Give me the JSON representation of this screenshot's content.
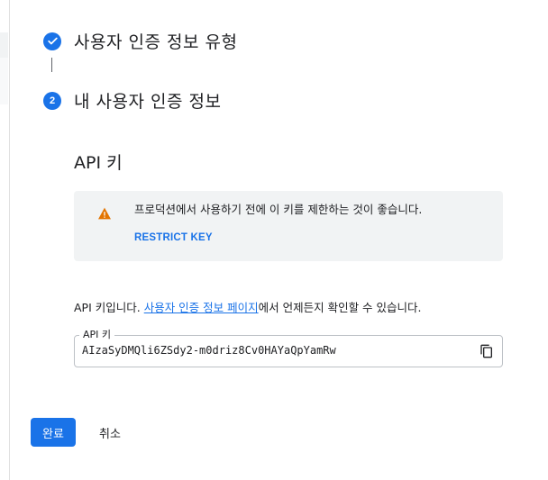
{
  "steps": [
    {
      "number": "",
      "title": "사용자 인증 정보 유형",
      "status": "complete",
      "icon": "check-icon"
    },
    {
      "number": "2",
      "title": "내 사용자 인증 정보",
      "status": "active"
    }
  ],
  "section": {
    "title": "API 키"
  },
  "warning": {
    "icon": "warning-icon",
    "text": "프로덕션에서 사용하기 전에 이 키를 제한하는 것이 좋습니다.",
    "action_label": "RESTRICT KEY"
  },
  "info": {
    "prefix": "API 키입니다. ",
    "link_text": "사용자 인증 정보 페이지",
    "suffix": "에서 언제든지 확인할 수 있습니다."
  },
  "key_field": {
    "label": "API 키",
    "value": "AIzaSyDMQli6ZSdy2-m0driz8Cv0HAYaQpYamRw",
    "copy_icon": "copy-icon"
  },
  "actions": {
    "done_label": "완료",
    "cancel_label": "취소"
  },
  "colors": {
    "accent": "#1a73e8",
    "warning": "#e37400",
    "panel_bg": "#f1f3f4"
  }
}
